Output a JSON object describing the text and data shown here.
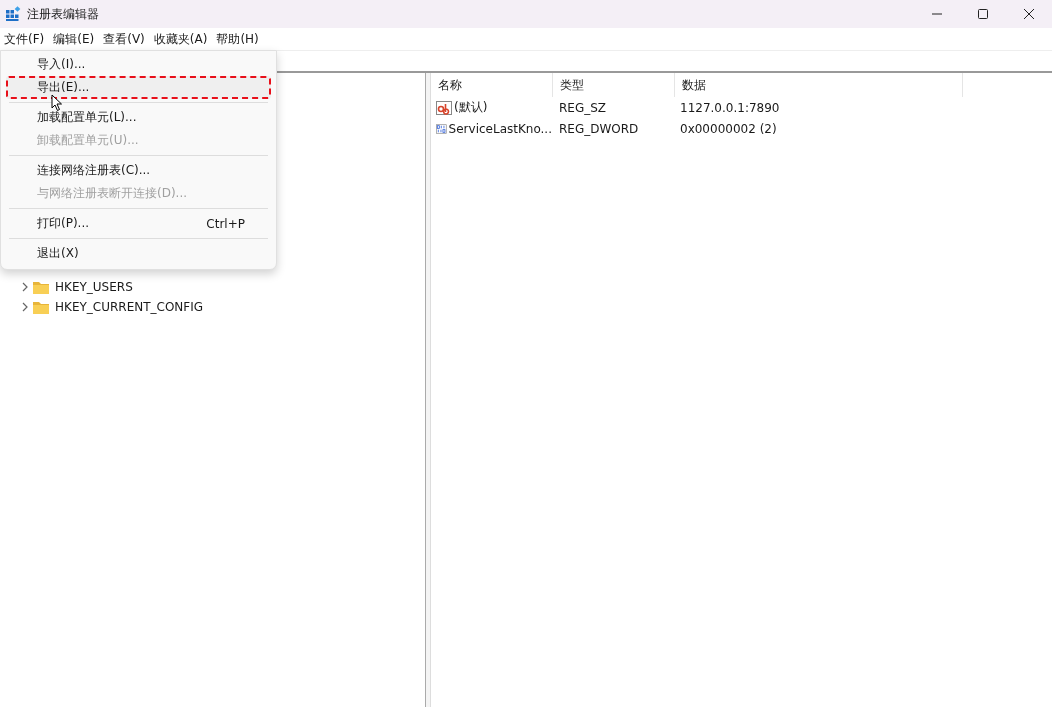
{
  "window": {
    "title": "注册表编辑器"
  },
  "menu_bar": [
    "文件(F)",
    "编辑(E)",
    "查看(V)",
    "收藏夹(A)",
    "帮助(H)"
  ],
  "file_menu": [
    {
      "kind": "item",
      "label": "导入(I)...",
      "disabled": false,
      "highlighted": false
    },
    {
      "kind": "item",
      "label": "导出(E)...",
      "disabled": false,
      "highlighted": true
    },
    {
      "kind": "separator"
    },
    {
      "kind": "item",
      "label": "加载配置单元(L)...",
      "disabled": false,
      "highlighted": false
    },
    {
      "kind": "item",
      "label": "卸载配置单元(U)...",
      "disabled": true,
      "highlighted": false
    },
    {
      "kind": "separator"
    },
    {
      "kind": "item",
      "label": "连接网络注册表(C)...",
      "disabled": false,
      "highlighted": false
    },
    {
      "kind": "item",
      "label": "与网络注册表断开连接(D)...",
      "disabled": true,
      "highlighted": false
    },
    {
      "kind": "separator"
    },
    {
      "kind": "item",
      "label": "打印(P)...",
      "shortcut": "Ctrl+P",
      "disabled": false,
      "highlighted": false
    },
    {
      "kind": "separator"
    },
    {
      "kind": "item",
      "label": "退出(X)",
      "disabled": false,
      "highlighted": false
    }
  ],
  "tree": [
    {
      "label": "HKEY_USERS"
    },
    {
      "label": "HKEY_CURRENT_CONFIG"
    }
  ],
  "table": {
    "columns": [
      "名称",
      "类型",
      "数据"
    ],
    "rows": [
      {
        "kind": "string",
        "name": "(默认)",
        "type": "REG_SZ",
        "data": "1127.0.0.1:7890"
      },
      {
        "kind": "binary",
        "name": "ServiceLastKno...",
        "type": "REG_DWORD",
        "data": "0x00000002 (2)"
      }
    ]
  }
}
